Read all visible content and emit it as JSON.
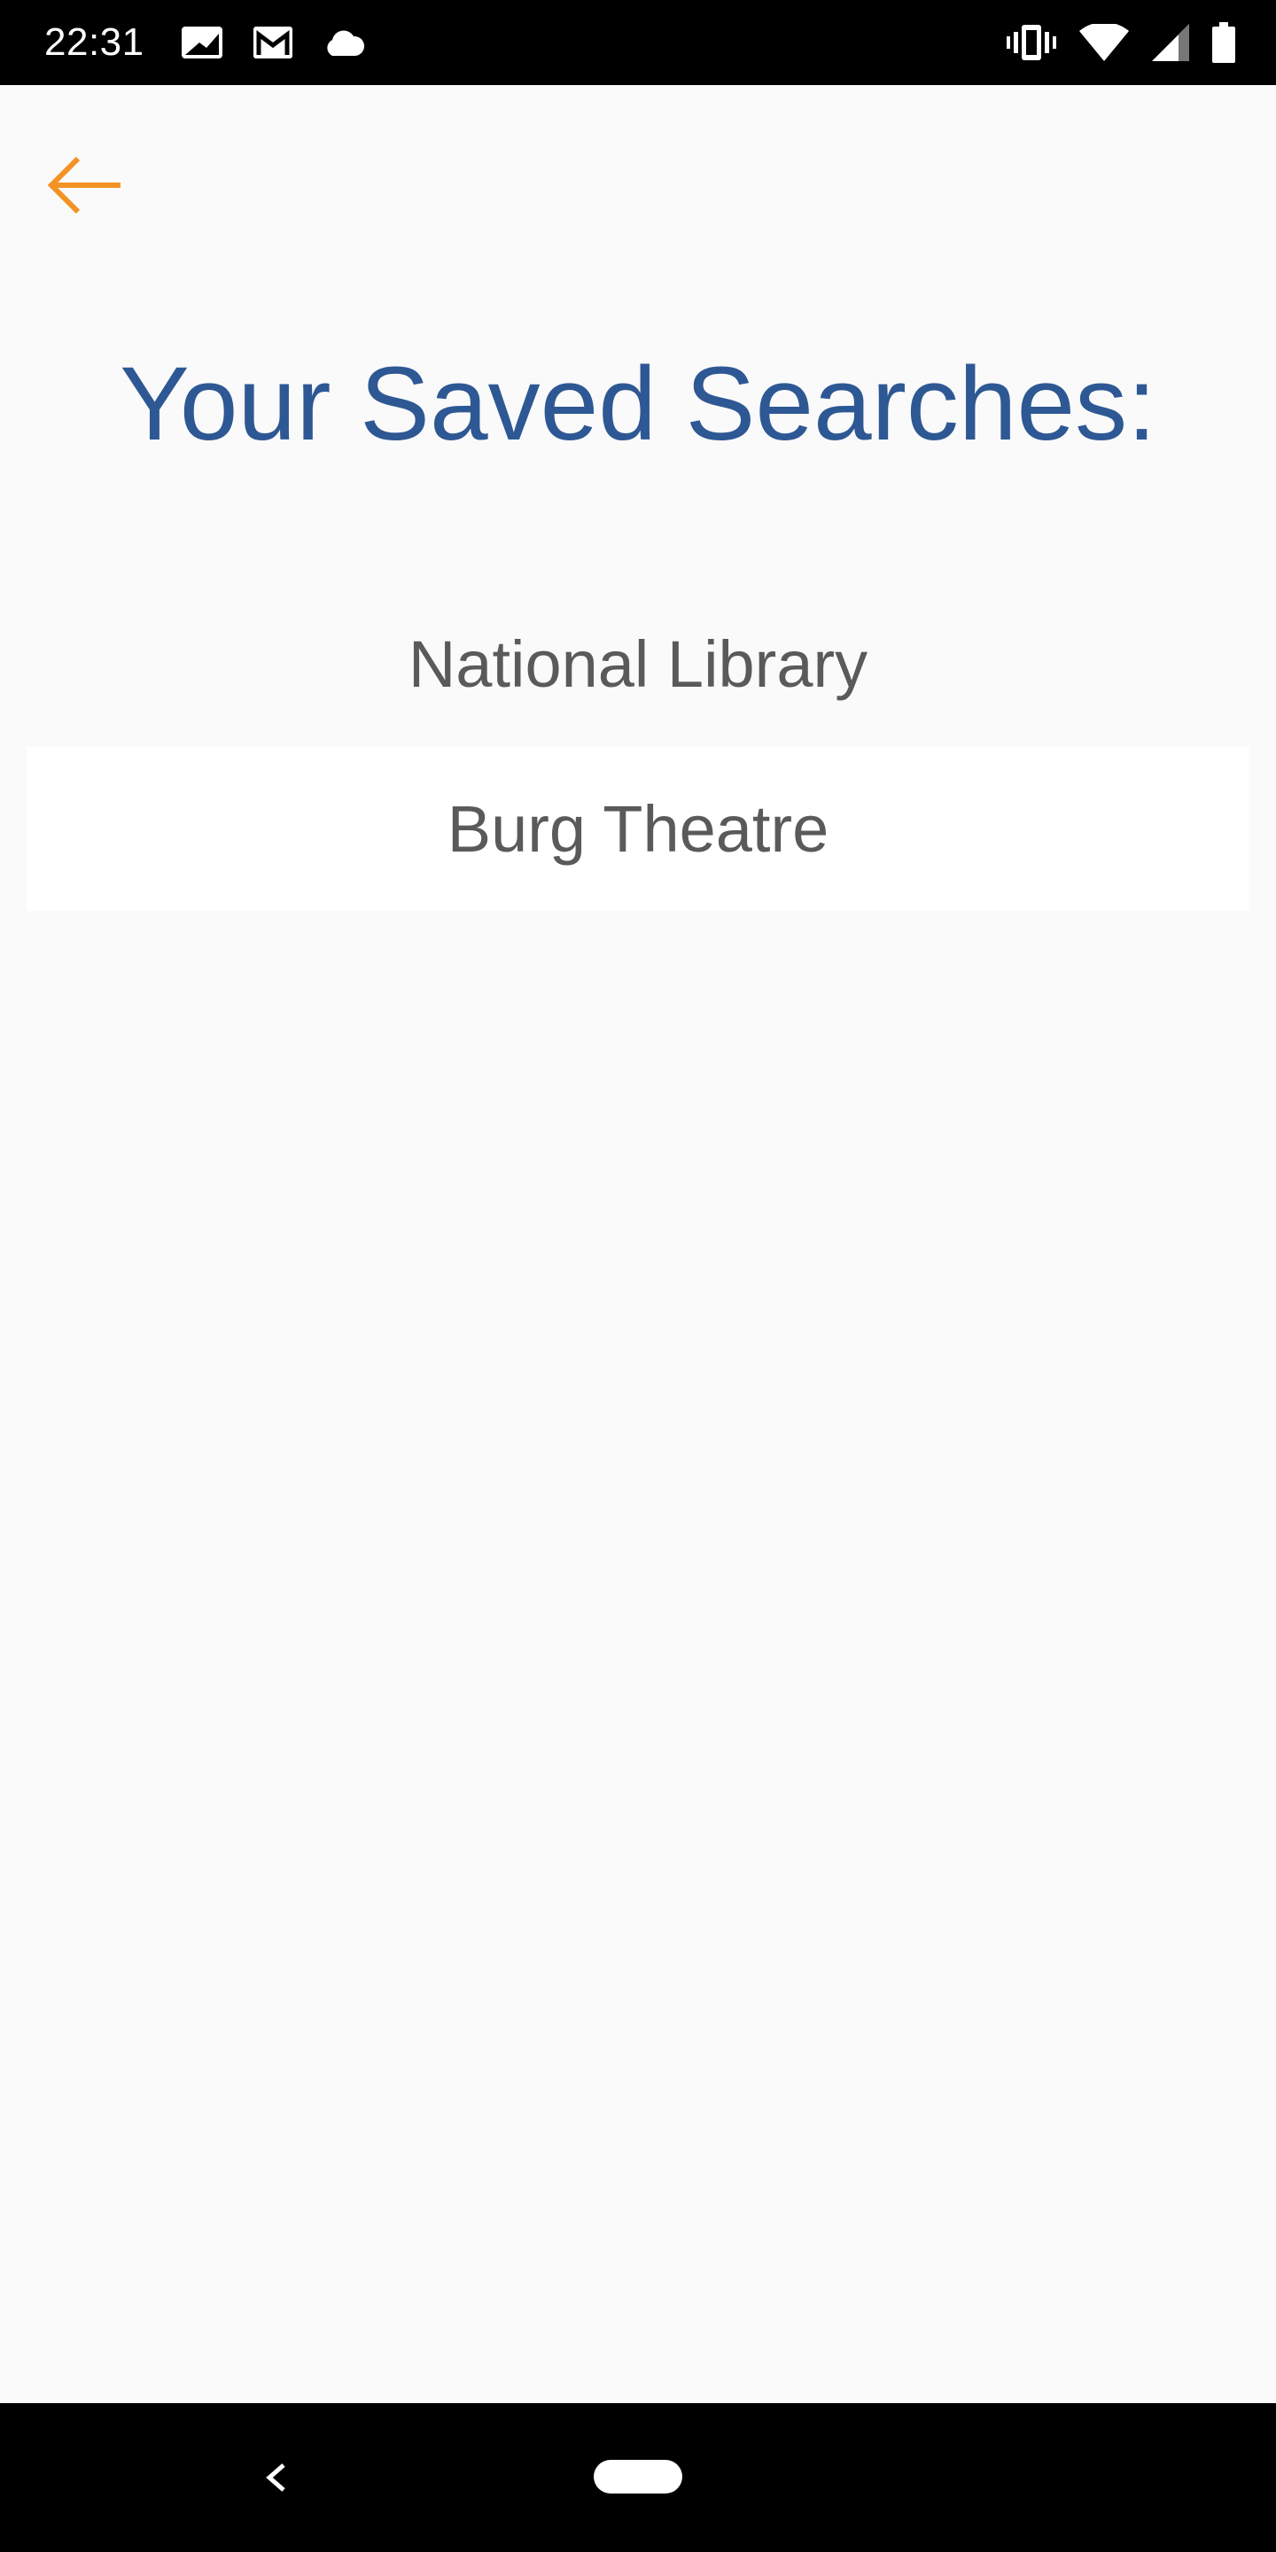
{
  "status_bar": {
    "time": "22:31",
    "left_icons": [
      "image-icon",
      "gmail-icon",
      "cloud-icon"
    ],
    "right_icons": [
      "vibrate-icon",
      "wifi-icon",
      "signal-icon",
      "battery-icon"
    ]
  },
  "header": {
    "back_icon": "arrow-left-icon",
    "title": "Your Saved Searches:"
  },
  "saved_searches": [
    {
      "label": "National Library",
      "selected": false
    },
    {
      "label": "Burg Theatre",
      "selected": true
    }
  ],
  "nav_bar": {
    "back_icon": "chevron-left-icon",
    "home_icon": "home-pill-icon"
  },
  "colors": {
    "accent": "#f39325",
    "title": "#2e5894",
    "text": "#5a5a5a",
    "background": "#fafafa"
  }
}
